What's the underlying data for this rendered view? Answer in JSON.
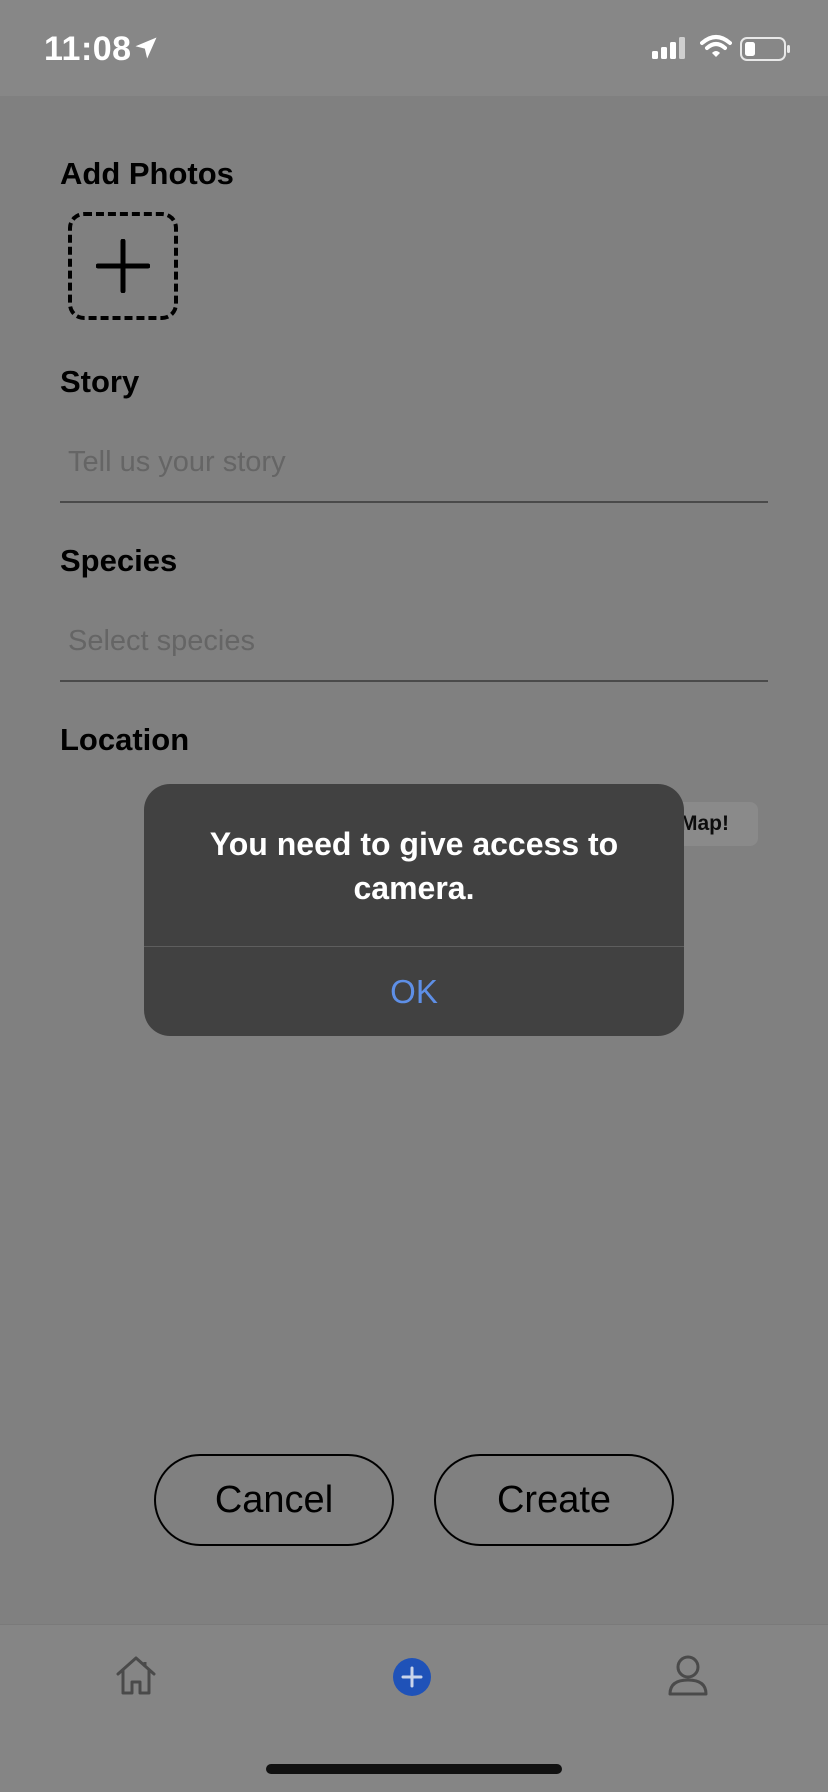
{
  "status_bar": {
    "time": "11:08"
  },
  "form": {
    "photos_label": "Add Photos",
    "story_label": "Story",
    "story_placeholder": "Tell us your story",
    "species_label": "Species",
    "species_placeholder": "Select species",
    "location_label": "Location",
    "map_button_partial": "Map!"
  },
  "alert": {
    "message": "You need to give access to camera.",
    "ok_label": "OK"
  },
  "actions": {
    "cancel_label": "Cancel",
    "create_label": "Create"
  },
  "tab_bar": {
    "items": [
      "home-icon",
      "add-circle-icon",
      "profile-icon"
    ],
    "active_color": "#1f52b8"
  },
  "colors": {
    "alert_bg": "#414141",
    "alert_button": "#5e8fe6",
    "overlay": "#808080"
  }
}
